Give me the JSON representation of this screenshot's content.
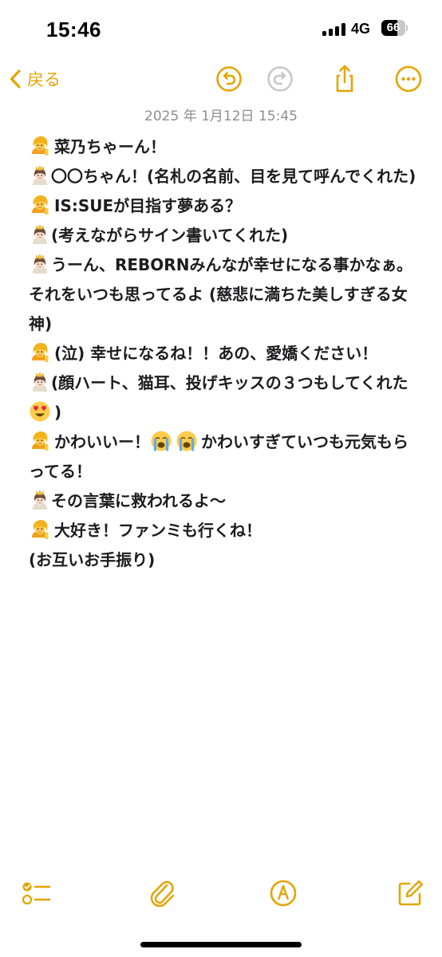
{
  "status_bar": {
    "time": "15:46",
    "network": "4G",
    "battery": "66",
    "battery_level_percent": 66
  },
  "nav": {
    "back_label": "戻る",
    "icons": [
      "undo-icon",
      "redo-icon",
      "share-icon",
      "more-icon"
    ]
  },
  "note": {
    "timestamp": "2025 年 1月12日 15:45",
    "lines": [
      {
        "emoji": "tipping-hand-emoji",
        "text": "菜乃ちゃーん！"
      },
      {
        "emoji": "princess-emoji",
        "text": "〇〇ちゃん！(名札の名前、目を見て呼んでくれた)"
      },
      {
        "emoji": "tipping-hand-emoji",
        "text": "IS:SUEが目指す夢ある？"
      },
      {
        "emoji": "princess-emoji",
        "text": "(考えながらサイン書いてくれた)"
      },
      {
        "emoji": "princess-emoji",
        "text": "うーん、REBORNみんなが幸せになる事かなぁ。それをいつも思ってるよ (慈悲に満ちた美しすぎる女神)"
      },
      {
        "emoji": "tipping-hand-emoji",
        "text": "(泣) 幸せになるね！！あの、愛嬌ください！"
      },
      {
        "emoji": "princess-emoji",
        "text": "(顔ハート、猫耳、投げキッスの３つもしてくれた",
        "tail_emoji": "heart-eyes-emoji",
        "tail_text": ")"
      },
      {
        "emoji": "tipping-hand-emoji",
        "text": "かわいいー！",
        "mid_emojis": [
          "crying-emoji",
          "crying-emoji"
        ],
        "tail_text": "かわいすぎていつも元気もらってる！"
      },
      {
        "emoji": "princess-emoji",
        "text": "その言葉に救われるよ〜"
      },
      {
        "emoji": "tipping-hand-emoji",
        "text": "大好き！ファンミも行くね！"
      },
      {
        "emoji": "",
        "text": "(お互いお手振り)"
      }
    ]
  },
  "toolbar": {
    "icons": [
      "checklist-icon",
      "attachment-icon",
      "markup-icon",
      "compose-icon"
    ]
  },
  "colors": {
    "accent": "#e5a400",
    "text": "#1c1c1e",
    "muted": "#8e8e93",
    "background": "#ffffff"
  }
}
